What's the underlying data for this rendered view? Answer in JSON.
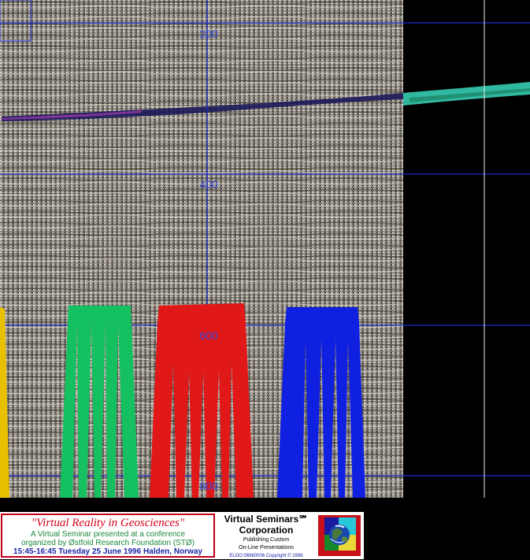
{
  "seismic_view": {
    "depth_labels": [
      "200",
      "400",
      "600",
      "800"
    ],
    "colors": {
      "background": "#000000",
      "grid_line": "#1a2bd0",
      "well_yellow": "#e8c000",
      "well_green": "#14c060",
      "well_red": "#e01818",
      "well_blue": "#1020e0",
      "horizon_bright": "#30b8a0"
    }
  },
  "banner": {
    "title": "\"Virtual Reality in Geosciences\"",
    "line1": "A Virtual Seminar presented at a conference",
    "line2": "organized by Østfold Research Foundation (STØ)",
    "line3": "15:45-16:45 Tuesday 25 June 1996 Halden, Norway",
    "corp_name_1": "Virtual Seminars℠",
    "corp_name_2": "Corporation",
    "tagline_1": "Publishing Custom",
    "tagline_2": "On-Line Presentations",
    "copyright": "ELDO 06960006 Copyright © 1996",
    "logo_icon": "earth-globe-icon"
  }
}
